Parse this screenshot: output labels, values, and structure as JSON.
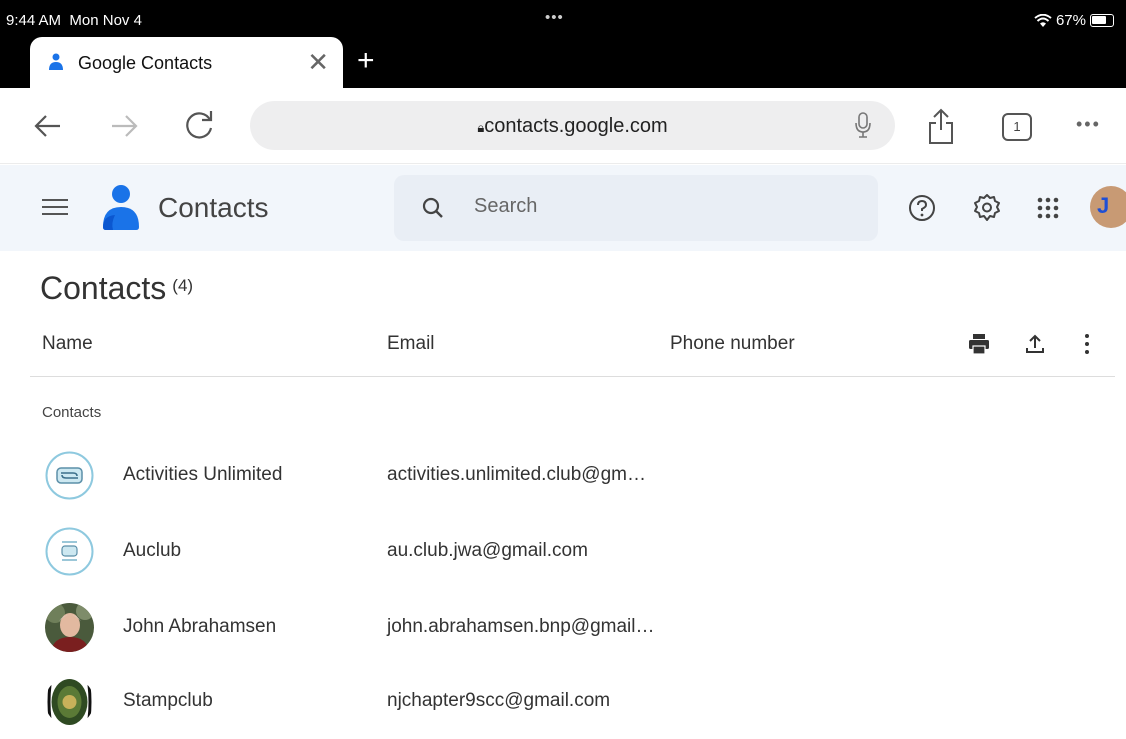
{
  "status_bar": {
    "time": "9:44 AM",
    "date": "Mon Nov 4",
    "battery": "67%"
  },
  "browser": {
    "tab_title": "Google Contacts",
    "url": "contacts.google.com",
    "tab_count": "1"
  },
  "header": {
    "app_name": "Contacts",
    "search_placeholder": "Search",
    "avatar_initial": "J"
  },
  "list": {
    "title": "Contacts",
    "count": "(4)",
    "columns": {
      "name": "Name",
      "email": "Email",
      "phone": "Phone number"
    },
    "section_label": "Contacts",
    "rows": [
      {
        "name": "Activities Unlimited",
        "email": "activities.unlimited.club@gm…"
      },
      {
        "name": "Auclub",
        "email": "au.club.jwa@gmail.com"
      },
      {
        "name": "John Abrahamsen",
        "email": "john.abrahamsen.bnp@gmail…"
      },
      {
        "name": "Stampclub",
        "email": "njchapter9scc@gmail.com"
      }
    ]
  },
  "colors": {
    "header_bg": "#f2f6fb",
    "brand_blue": "#1a73e8",
    "text": "#333333"
  },
  "icons": [
    "wifi-icon",
    "battery-icon",
    "close-icon",
    "plus-icon",
    "back-icon",
    "forward-icon",
    "reload-icon",
    "lock-icon",
    "mic-icon",
    "share-icon",
    "tabs-icon",
    "more-icon",
    "menu-icon",
    "search-icon",
    "help-icon",
    "settings-icon",
    "apps-icon",
    "print-icon",
    "export-icon",
    "more-vert-icon"
  ]
}
